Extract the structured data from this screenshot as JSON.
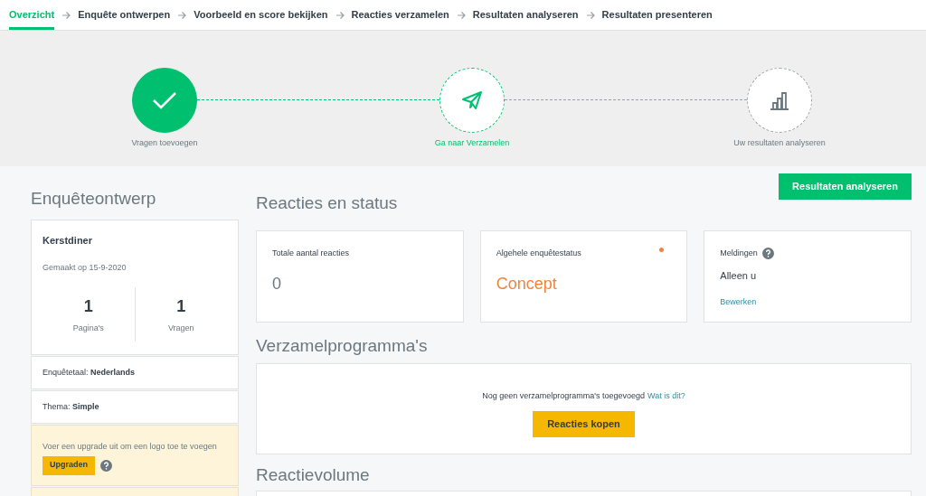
{
  "nav_tabs": [
    {
      "label": "Overzicht",
      "selected": true
    },
    {
      "label": "Enquête ontwerpen",
      "selected": false
    },
    {
      "label": "Voorbeeld en score bekijken",
      "selected": false
    },
    {
      "label": "Reacties verzamelen",
      "selected": false
    },
    {
      "label": "Resultaten analyseren",
      "selected": false
    },
    {
      "label": "Resultaten presenteren",
      "selected": false
    }
  ],
  "progress_steps": [
    {
      "label": "Vragen toevoegen",
      "kind": "done"
    },
    {
      "label": "Ga naar Verzamelen",
      "kind": "current"
    },
    {
      "label": "Uw resultaten analyseren",
      "kind": "todo"
    }
  ],
  "survey_design": {
    "heading": "Enquêteontwerp",
    "title": "Kerstdiner",
    "created": "Gemaakt op 15-9-2020",
    "stats": [
      {
        "value": "1",
        "label": "Pagina's"
      },
      {
        "value": "1",
        "label": "Vragen"
      }
    ],
    "language": "Enquêtetaal: **Nederlands**",
    "theme": "Thema: **Simple**",
    "upgrade_note": "Voer een upgrade uit om een logo toe te voegen",
    "upgrade_button": "Upgraden"
  },
  "responses_status": {
    "heading": "Reacties en status",
    "analyze_button": "Resultaten analyseren",
    "total": {
      "label": "Totale aantal reacties",
      "value": "0"
    },
    "status": {
      "label": "Algehele enquêtestatus",
      "value": "Concept",
      "color": "#f0843c"
    },
    "notifications": {
      "label": "Meldingen",
      "value": "Alleen u",
      "link": "Bewerken"
    }
  },
  "collectors": {
    "heading": "Verzamelprogramma's",
    "empty_text": "Nog geen verzamelprogramma's toegevoegd",
    "help_link": "Wat is dit?",
    "buy_button": "Reacties kopen"
  },
  "volume": {
    "heading": "Reactievolume"
  }
}
